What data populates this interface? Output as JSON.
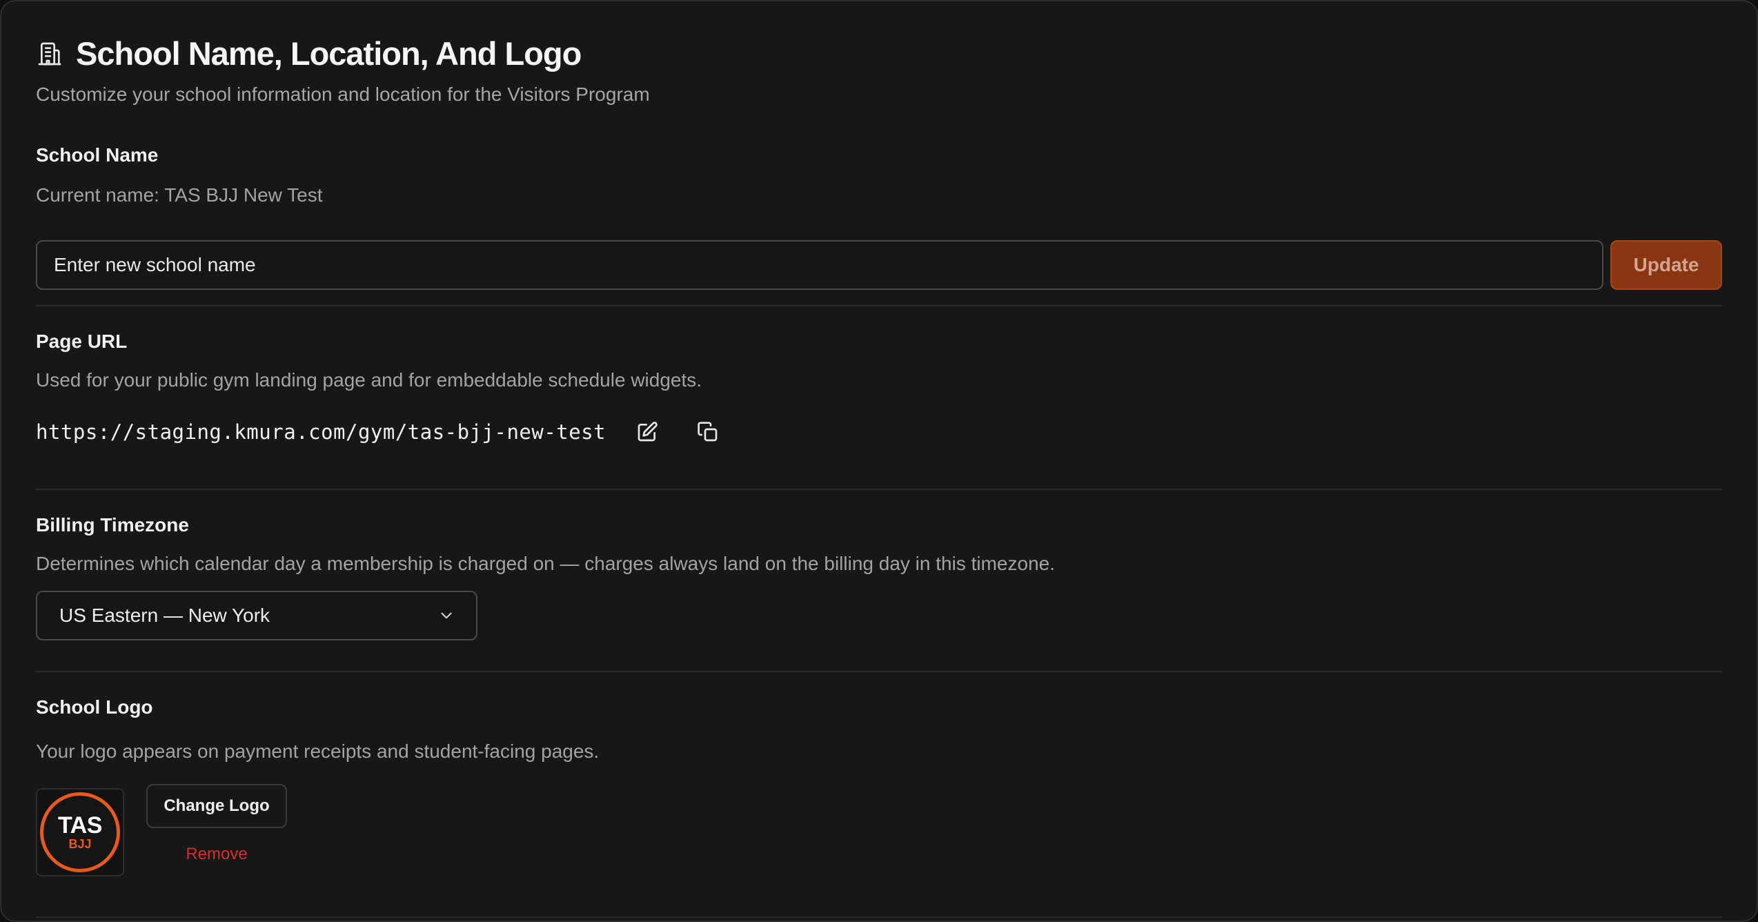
{
  "header": {
    "title": "School Name, Location, And Logo",
    "subtitle": "Customize your school information and location for the Visitors Program",
    "icon": "building-icon"
  },
  "school_name": {
    "label": "School Name",
    "current": "Current name: TAS BJJ New Test",
    "input_placeholder": "Enter new school name",
    "update_label": "Update"
  },
  "page_url": {
    "label": "Page URL",
    "description": "Used for your public gym landing page and for embeddable schedule widgets.",
    "url": "https://staging.kmura.com/gym/tas-bjj-new-test",
    "edit_icon": "edit-icon",
    "copy_icon": "copy-icon"
  },
  "billing_timezone": {
    "label": "Billing Timezone",
    "description": "Determines which calendar day a membership is charged on — charges always land on the billing day in this timezone.",
    "selected": "US Eastern — New York"
  },
  "school_logo": {
    "label": "School Logo",
    "description": "Your logo appears on payment receipts and student-facing pages.",
    "logo_text_top": "TAS",
    "logo_text_bottom": "BJJ",
    "change_label": "Change Logo",
    "remove_label": "Remove"
  },
  "colors": {
    "accent": "#e65a1e",
    "update_button_bg": "#8a3511",
    "remove_text": "#d32f2f"
  }
}
